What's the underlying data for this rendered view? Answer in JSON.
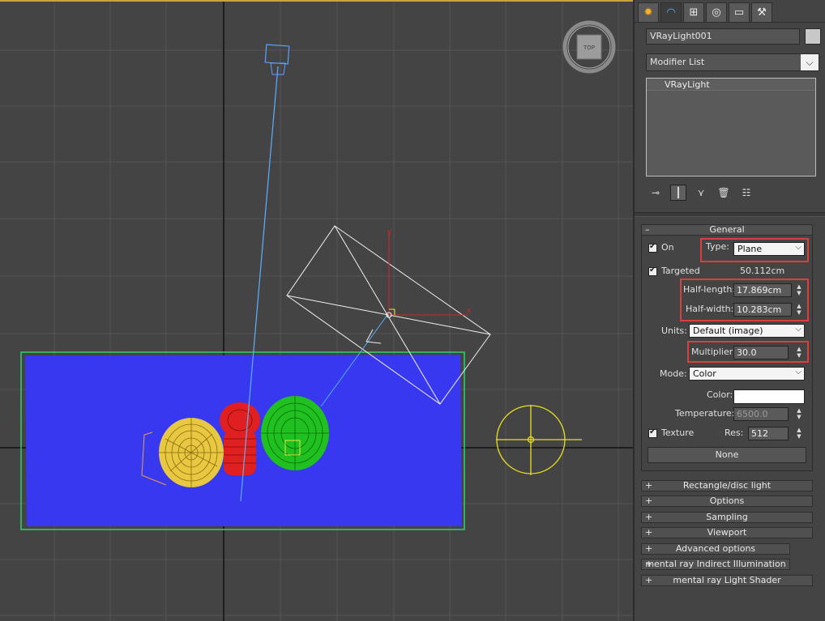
{
  "viewcube": {
    "face_label": "TOP"
  },
  "gizmo_axes": {
    "x": "x",
    "y": "y"
  },
  "tabs": [
    {
      "icon": "create-icon"
    },
    {
      "icon": "modify-icon"
    },
    {
      "icon": "hierarchy-icon"
    },
    {
      "icon": "motion-icon"
    },
    {
      "icon": "display-icon"
    },
    {
      "icon": "utilities-icon"
    }
  ],
  "object_name": "VRayLight001",
  "modifier_list": "Modifier List",
  "stack_items": [
    "VRayLight"
  ],
  "general": {
    "title": "General",
    "collapse_sign": "–",
    "on_label": "On",
    "type_label": "Type:",
    "type_value": "Plane",
    "targeted_label": "Targeted",
    "targeted_value": "50.112cm",
    "half_length_label": "Half-length:",
    "half_length_value": "17.869cm",
    "half_width_label": "Half-width:",
    "half_width_value": "10.283cm",
    "units_label": "Units:",
    "units_value": "Default (image)",
    "multiplier_label": "Multiplier:",
    "multiplier_value": "30.0",
    "mode_label": "Mode:",
    "mode_value": "Color",
    "color_label": "Color:",
    "temperature_label": "Temperature:",
    "temperature_value": "6500.0",
    "texture_label": "Texture",
    "res_label": "Res:",
    "res_value": "512",
    "texture_button": "None"
  },
  "rollouts": [
    "Rectangle/disc light",
    "Options",
    "Sampling",
    "Viewport",
    "Advanced options",
    "mental ray Indirect Illumination",
    "mental ray Light Shader"
  ],
  "rollout_sign": "+",
  "colors": {
    "viewport_bg": "#444444",
    "plane": "#3838f0",
    "plane_border": "#30d070",
    "yellow_object": "#e8c840",
    "red_object": "#e02020",
    "green_object": "#20c020",
    "highlight": "#d84040"
  }
}
